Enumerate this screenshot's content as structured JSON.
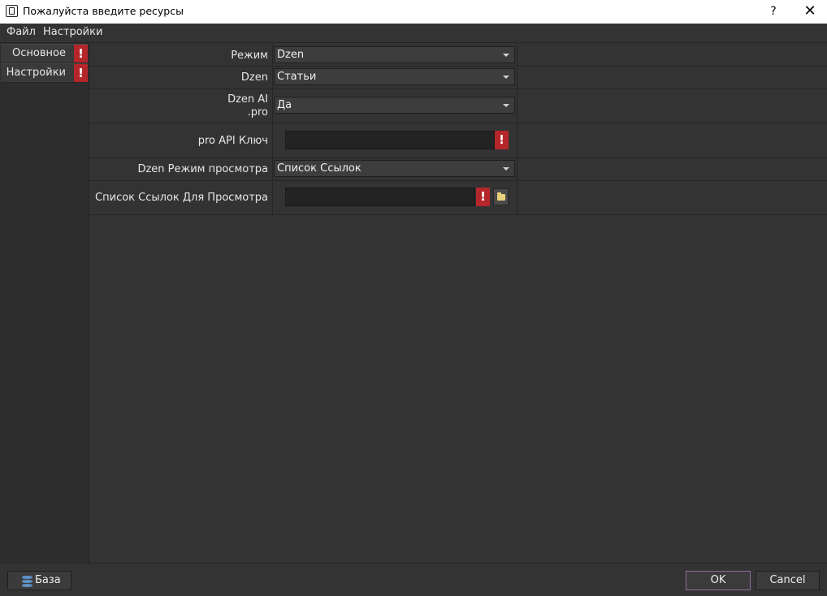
{
  "window": {
    "title": "Пожалуйста введите ресурсы",
    "help_label": "?",
    "close_label": "✕"
  },
  "menu": [
    {
      "label": "Файл"
    },
    {
      "label": "Настройки"
    }
  ],
  "sidebar": {
    "tabs": [
      {
        "label": "Основное",
        "warning": "!"
      },
      {
        "label": "Настройки",
        "warning": "!"
      }
    ]
  },
  "form": {
    "rows": [
      {
        "label": "Режим",
        "value": "Dzen"
      },
      {
        "label": "Dzen",
        "value": "Статьи"
      },
      {
        "label_line1": "Dzen AI",
        "label_line2": ".pro",
        "value": "Да"
      },
      {
        "label": "pro API Ключ",
        "value": "",
        "warning": "!"
      },
      {
        "label": "Dzen Режим просмотра",
        "value": "Список Ссылок"
      },
      {
        "label": "Список Ссылок Для Просмотра",
        "value": "",
        "warning": "!"
      }
    ]
  },
  "footer": {
    "db_button": "База",
    "ok": "OK",
    "cancel": "Cancel"
  },
  "colors": {
    "background": "#333333",
    "warning": "#b5262b",
    "ok_border": "#8d6a9f",
    "db_icon": "#5d93c7"
  },
  "icons": [
    "app-icon",
    "warning-icon",
    "dropdown-arrow-icon",
    "folder-icon",
    "database-icon"
  ]
}
